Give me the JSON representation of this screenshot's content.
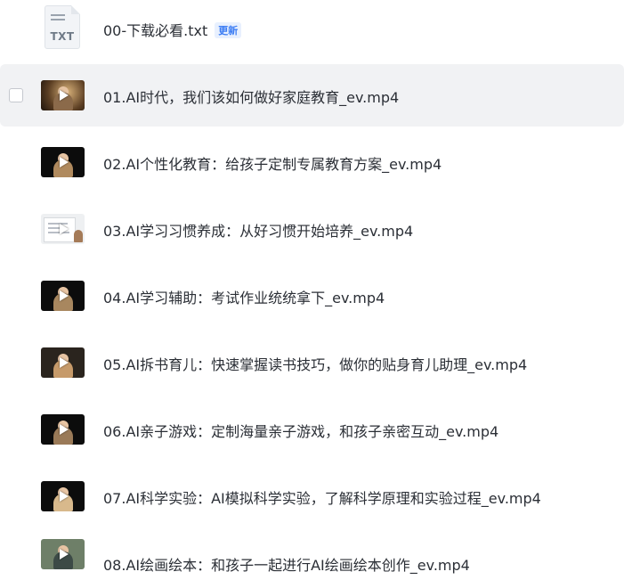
{
  "files": [
    {
      "name": "00-下载必看.txt",
      "badge": "更新",
      "icon_label": "TXT"
    },
    {
      "name": "01.AI时代，我们该如何做好家庭教育_ev.mp4"
    },
    {
      "name": "02.AI个性化教育：给孩子定制专属教育方案_ev.mp4"
    },
    {
      "name": "03.AI学习习惯养成：从好习惯开始培养_ev.mp4"
    },
    {
      "name": "04.AI学习辅助：考试作业统统拿下_ev.mp4"
    },
    {
      "name": "05.AI拆书育儿：快速掌握读书技巧，做你的贴身育儿助理_ev.mp4"
    },
    {
      "name": "06.AI亲子游戏：定制海量亲子游戏，和孩子亲密互动_ev.mp4"
    },
    {
      "name": "07.AI科学实验：AI模拟科学实验，了解科学原理和实验过程_ev.mp4"
    },
    {
      "name": "08.AI绘画绘本：和孩子一起进行AI绘画绘本创作_ev.mp4"
    }
  ]
}
